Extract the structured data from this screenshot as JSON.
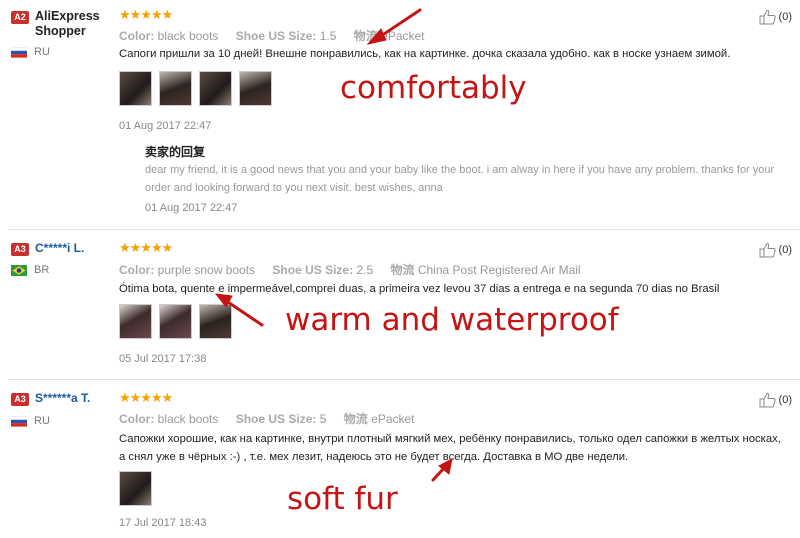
{
  "reviews": [
    {
      "badge": "A2",
      "user": "AliExpress Shopper",
      "country": "RU",
      "stars": "★★★★★",
      "color_label": "Color:",
      "color_value": "black boots",
      "size_label": "Shoe US Size:",
      "size_value": "1.5",
      "shipping_label": "物流",
      "shipping_value": "ePacket",
      "text": "Сапоги пришли за 10 дней! Внешне понравились, как на картинке. дочка сказала удобно. как в носке узнаем зимой.",
      "date": "01 Aug 2017 22:47",
      "likes": "(0)",
      "reply_title": "卖家的回复",
      "reply_text": "dear my friend, it is a good news that you and your baby like the boot. i am alway in here if you have any problem. thanks for your order and looking forward to you next visit. best wishes, anna",
      "reply_date": "01 Aug 2017 22:47"
    },
    {
      "badge": "A3",
      "user": "C*****i L.",
      "country": "BR",
      "stars": "★★★★★",
      "color_label": "Color:",
      "color_value": "purple snow boots",
      "size_label": "Shoe US Size:",
      "size_value": "2.5",
      "shipping_label": "物流",
      "shipping_value": "China Post Registered Air Mail",
      "text": "Ótima bota, quente e impermeável,comprei duas, a primeira vez levou 37 dias a entrega e na segunda 70 dias no Brasil",
      "date": "05 Jul 2017 17:38",
      "likes": "(0)"
    },
    {
      "badge": "A3",
      "user": "S******a T.",
      "country": "RU",
      "stars": "★★★★★",
      "color_label": "Color:",
      "color_value": "black boots",
      "size_label": "Shoe US Size:",
      "size_value": "5",
      "shipping_label": "物流",
      "shipping_value": "ePacket",
      "text": "Сапожки хорошие, как на картинке, внутри плотный мягкий мех, ребёнку понравились, только одел сапожки в желтых носках, а снял уже в чёрных :-) , т.е. мех лезит, надеюсь это не будет всегда. Доставка в МО две недели.",
      "date": "17 Jul 2017 18:43",
      "likes": "(0)"
    }
  ],
  "annotations": {
    "a1": "comfortably",
    "a2": "warm and waterproof",
    "a3": "soft fur",
    "color": "#c41414"
  },
  "icons": [
    "thumbs-up-icon",
    "flag-ru-icon",
    "flag-br-icon",
    "star-icon"
  ]
}
